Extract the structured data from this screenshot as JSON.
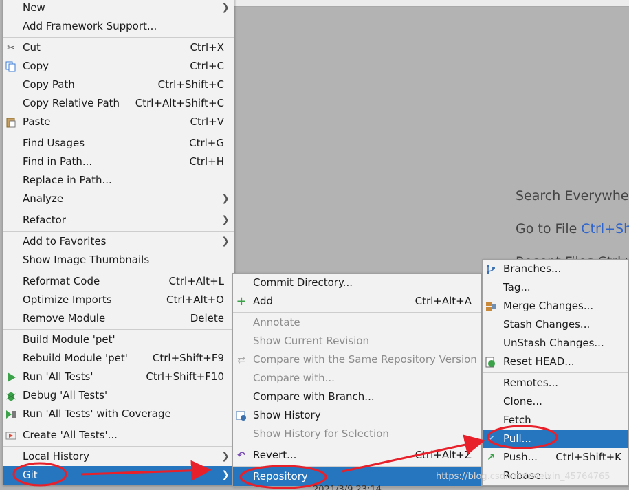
{
  "editor": {
    "hint_search": "Search Everywhere",
    "hint_goto_label": "Go to File ",
    "hint_goto_shortcut": "Ctrl+Sh",
    "hint_recent": "Recent Files Ctrl+E"
  },
  "context_menu": {
    "items": [
      {
        "label": "New",
        "shortcut": "",
        "submenu": true
      },
      {
        "label": "Add Framework Support...",
        "shortcut": ""
      },
      {
        "label": "Cut",
        "shortcut": "Ctrl+X",
        "icon": "scissors-icon"
      },
      {
        "label": "Copy",
        "shortcut": "Ctrl+C",
        "icon": "copy-icon"
      },
      {
        "label": "Copy Path",
        "shortcut": "Ctrl+Shift+C"
      },
      {
        "label": "Copy Relative Path",
        "shortcut": "Ctrl+Alt+Shift+C"
      },
      {
        "label": "Paste",
        "shortcut": "Ctrl+V",
        "icon": "paste-icon"
      },
      {
        "label": "Find Usages",
        "shortcut": "Ctrl+G"
      },
      {
        "label": "Find in Path...",
        "shortcut": "Ctrl+H"
      },
      {
        "label": "Replace in Path...",
        "shortcut": ""
      },
      {
        "label": "Analyze",
        "shortcut": "",
        "submenu": true
      },
      {
        "label": "Refactor",
        "shortcut": "",
        "submenu": true
      },
      {
        "label": "Add to Favorites",
        "shortcut": "",
        "submenu": true
      },
      {
        "label": "Show Image Thumbnails",
        "shortcut": ""
      },
      {
        "label": "Reformat Code",
        "shortcut": "Ctrl+Alt+L"
      },
      {
        "label": "Optimize Imports",
        "shortcut": "Ctrl+Alt+O"
      },
      {
        "label": "Remove Module",
        "shortcut": "Delete"
      },
      {
        "label": "Build Module 'pet'",
        "shortcut": ""
      },
      {
        "label": "Rebuild Module 'pet'",
        "shortcut": "Ctrl+Shift+F9"
      },
      {
        "label": "Run 'All Tests'",
        "shortcut": "Ctrl+Shift+F10",
        "icon": "run-icon"
      },
      {
        "label": "Debug 'All Tests'",
        "shortcut": "",
        "icon": "debug-icon"
      },
      {
        "label": "Run 'All Tests' with Coverage",
        "shortcut": "",
        "icon": "coverage-icon"
      },
      {
        "label": "Create 'All Tests'...",
        "shortcut": "",
        "icon": "create-test-icon"
      },
      {
        "label": "Local History",
        "shortcut": "",
        "submenu": true
      },
      {
        "label": "Git",
        "shortcut": "",
        "submenu": true,
        "selected": true
      }
    ]
  },
  "git_menu": {
    "items": [
      {
        "label": "Commit Directory...",
        "shortcut": ""
      },
      {
        "label": "Add",
        "shortcut": "Ctrl+Alt+A",
        "icon": "plus-icon"
      },
      {
        "label": "Annotate",
        "shortcut": "",
        "disabled": true
      },
      {
        "label": "Show Current Revision",
        "shortcut": "",
        "disabled": true
      },
      {
        "label": "Compare with the Same Repository Version",
        "shortcut": "",
        "disabled": true,
        "icon": "compare-icon"
      },
      {
        "label": "Compare with...",
        "shortcut": "",
        "disabled": true
      },
      {
        "label": "Compare with Branch...",
        "shortcut": ""
      },
      {
        "label": "Show History",
        "shortcut": "",
        "icon": "history-icon"
      },
      {
        "label": "Show History for Selection",
        "shortcut": "",
        "disabled": true
      },
      {
        "label": "Revert...",
        "shortcut": "Ctrl+Alt+Z",
        "icon": "revert-icon"
      },
      {
        "label": "Repository",
        "shortcut": "",
        "submenu": true,
        "selected": true
      }
    ]
  },
  "repository_menu": {
    "items": [
      {
        "label": "Branches...",
        "shortcut": "",
        "icon": "branches-icon"
      },
      {
        "label": "Tag...",
        "shortcut": ""
      },
      {
        "label": "Merge Changes...",
        "shortcut": "",
        "icon": "merge-icon"
      },
      {
        "label": "Stash Changes...",
        "shortcut": ""
      },
      {
        "label": "UnStash Changes...",
        "shortcut": ""
      },
      {
        "label": "Reset HEAD...",
        "shortcut": "",
        "icon": "reset-icon"
      },
      {
        "label": "Remotes...",
        "shortcut": ""
      },
      {
        "label": "Clone...",
        "shortcut": ""
      },
      {
        "label": "Fetch",
        "shortcut": ""
      },
      {
        "label": "Pull...",
        "shortcut": "",
        "icon": "pull-icon",
        "selected": true
      },
      {
        "label": "Push...",
        "shortcut": "Ctrl+Shift+K",
        "icon": "push-icon"
      },
      {
        "label": "Rebase...",
        "shortcut": ""
      }
    ]
  },
  "watermark": "https://blog.csdn.net/weixin_45764765",
  "bottom_text": "2021/3/9 23:14",
  "colors": {
    "selection": "#2675bf",
    "annotation": "#e8202a",
    "menu_bg": "#f2f2f2"
  }
}
